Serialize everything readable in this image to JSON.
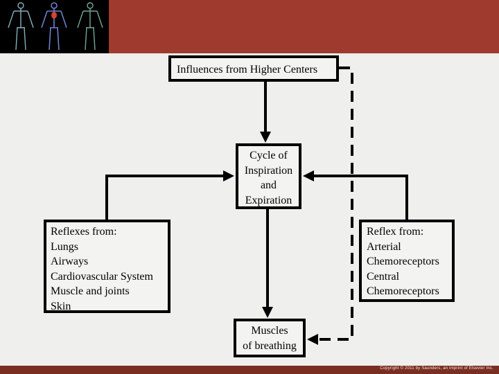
{
  "header": {
    "band_color": "#9e3a2e",
    "image_bg": "#000000",
    "image_alt": "human body anatomical figures (skeletal, circulatory, muscular)"
  },
  "diagram": {
    "higher_centers": {
      "lines": [
        "Influences from Higher Centers"
      ]
    },
    "cycle": {
      "lines": [
        "Cycle of",
        "Inspiration",
        "and",
        "Expiration"
      ]
    },
    "reflexes": {
      "lines": [
        "Reflexes from:",
        "Lungs",
        "Airways",
        "Cardiovascular System",
        "Muscle and joints",
        "Skin"
      ]
    },
    "reflex_from": {
      "lines": [
        "Reflex from:",
        "Arterial",
        "Chemoreceptors",
        "Central",
        "Chemoreceptors"
      ]
    },
    "muscles": {
      "lines": [
        "Muscles",
        "of breathing"
      ]
    },
    "connections": [
      {
        "from": "Influences from Higher Centers",
        "to": "Cycle of Inspiration and Expiration",
        "style": "solid"
      },
      {
        "from": "Reflexes from",
        "to": "Cycle of Inspiration and Expiration",
        "style": "solid"
      },
      {
        "from": "Reflex from (Chemoreceptors)",
        "to": "Cycle of Inspiration and Expiration",
        "style": "solid"
      },
      {
        "from": "Cycle of Inspiration and Expiration",
        "to": "Muscles of breathing",
        "style": "solid"
      },
      {
        "from": "Influences from Higher Centers",
        "to": "Muscles of breathing",
        "style": "dashed"
      }
    ]
  },
  "footer": {
    "band_color": "#7a2e22",
    "copyright": "Copyright © 2011 by Saunders, an imprint of Elsevier Inc."
  }
}
